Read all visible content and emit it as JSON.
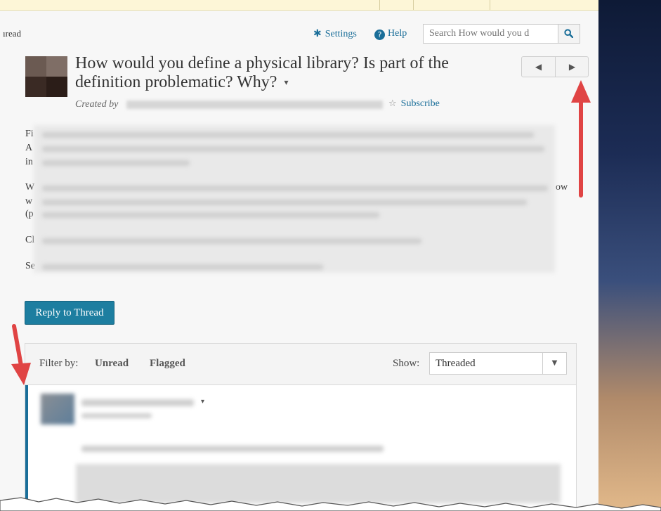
{
  "header": {
    "left_fragment": "ıread",
    "settings_label": "Settings",
    "help_label": "Help",
    "help_icon": "?",
    "search_placeholder": "Search How would you d"
  },
  "thread": {
    "title": "How would you define a physical library? Is part of the definition problematic? Why?",
    "title_caret": "▾",
    "created_by_label": "Created by",
    "subscribe_label": "Subscribe",
    "prev_arrow": "◀",
    "next_arrow": "▶"
  },
  "body_fragments": {
    "line1": "Fi",
    "line2": "A",
    "line3": "in",
    "line4": "W",
    "line4_right": "ow",
    "line5": "w",
    "line6": "(p",
    "line7": "Cl",
    "line8": "Se"
  },
  "actions": {
    "reply_label": "Reply to Thread"
  },
  "filter": {
    "filter_by_label": "Filter by:",
    "unread_label": "Unread",
    "flagged_label": "Flagged",
    "show_label": "Show:",
    "show_value": "Threaded",
    "dropdown_arrow": "▼"
  },
  "post": {
    "caret": "▾"
  },
  "icons": {
    "settings": "gear-icon",
    "help": "help-circle-icon",
    "search": "search-icon",
    "subscribe": "star-icon",
    "prev": "triangle-left-icon",
    "next": "triangle-right-icon"
  },
  "colors": {
    "link": "#1a6e99",
    "reply_button": "#1d7ea0",
    "annotation_arrow": "#e04444",
    "post_accent": "#1a6e99"
  }
}
